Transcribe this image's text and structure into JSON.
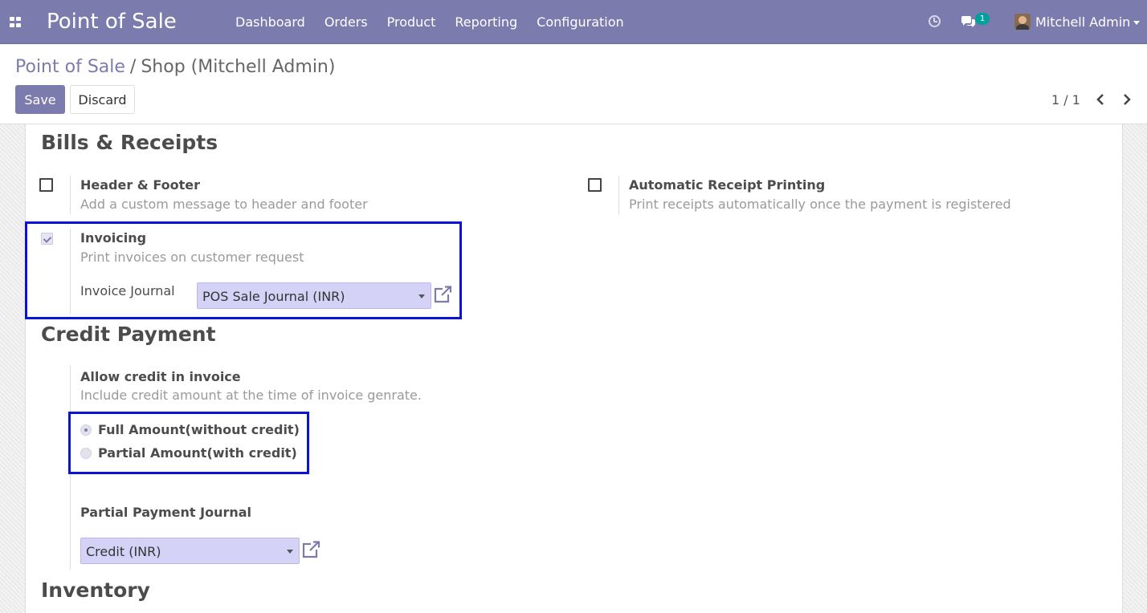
{
  "navbar": {
    "app_title": "Point of Sale",
    "menu": [
      "Dashboard",
      "Orders",
      "Product",
      "Reporting",
      "Configuration"
    ],
    "messages_badge": "1",
    "user_name": "Mitchell Admin",
    "icons": [
      "apps-grid-icon",
      "clock-icon",
      "chat-icon",
      "avatar",
      "caret-down-icon"
    ]
  },
  "control_panel": {
    "breadcrumb_root": "Point of Sale",
    "breadcrumb_separator": "/",
    "breadcrumb_current": "Shop (Mitchell Admin)",
    "save_label": "Save",
    "discard_label": "Discard",
    "pager": "1 / 1"
  },
  "bills_receipts": {
    "title": "Bills & Receipts",
    "header_footer": {
      "title": "Header & Footer",
      "help": "Add a custom message to header and footer",
      "checked": false
    },
    "auto_receipt": {
      "title": "Automatic Receipt Printing",
      "help": "Print receipts automatically once the payment is registered",
      "checked": false
    },
    "invoicing": {
      "title": "Invoicing",
      "help": "Print invoices on customer request",
      "checked": true,
      "journal_label": "Invoice Journal",
      "journal_value": "POS Sale Journal (INR)"
    }
  },
  "credit_payment": {
    "title": "Credit Payment",
    "allow_credit_title": "Allow credit in invoice",
    "allow_credit_help": "Include credit amount at the time of invoice genrate.",
    "options": [
      {
        "label": "Full Amount(without credit)",
        "selected": true
      },
      {
        "label": "Partial Amount(with credit)",
        "selected": false
      }
    ],
    "partial_journal_title": "Partial Payment Journal",
    "partial_journal_value": "Credit (INR)"
  },
  "inventory": {
    "title": "Inventory"
  },
  "colors": {
    "brand": "#7c7bad",
    "select_bg": "#d5d2f7",
    "highlight": "#0a14d8",
    "badge": "#00a09d"
  }
}
